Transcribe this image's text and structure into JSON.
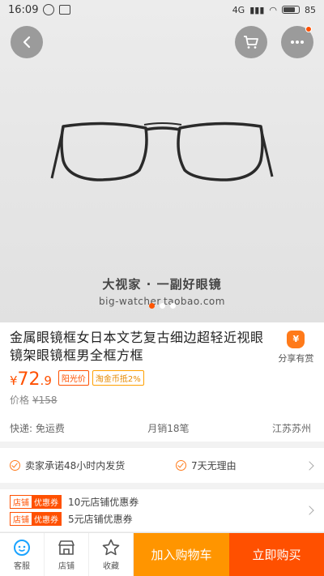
{
  "status_bar": {
    "time": "16:09",
    "network": "4G",
    "battery": "85"
  },
  "hero": {
    "brand_text": "大视家 · 一副好眼镜",
    "url_text": "big-watcher.taobao.com",
    "image_index": 1,
    "image_count": 3
  },
  "product": {
    "title": "金属眼镜框女日本文艺复古细边超轻近视眼镜架眼镜框男全框方框",
    "share_label": "分享有赏",
    "share_icon": "¥",
    "price_currency": "¥",
    "price_int": "72",
    "price_dec": ".9",
    "tag_discount": "阳光价",
    "tag_coin": "淘金币抵2%",
    "orig_label": "价格",
    "orig_price": "¥158",
    "shipping": "快递: 免运费",
    "monthly_sales": "月销18笔",
    "location": "江苏苏州"
  },
  "promises": {
    "item1": "卖家承诺48小时内发货",
    "item2": "7天无理由"
  },
  "coupons": [
    {
      "tag_a": "店铺",
      "tag_b": "优惠券",
      "text": "10元店铺优惠券"
    },
    {
      "tag_a": "店铺",
      "tag_b": "优惠券",
      "text": "5元店铺优惠券"
    }
  ],
  "bottom_bar": {
    "service": "客服",
    "store": "店铺",
    "favorite": "收藏",
    "add_cart": "加入购物车",
    "buy_now": "立即购买"
  },
  "colors": {
    "accent": "#ff5000",
    "cart": "#ff9500"
  }
}
